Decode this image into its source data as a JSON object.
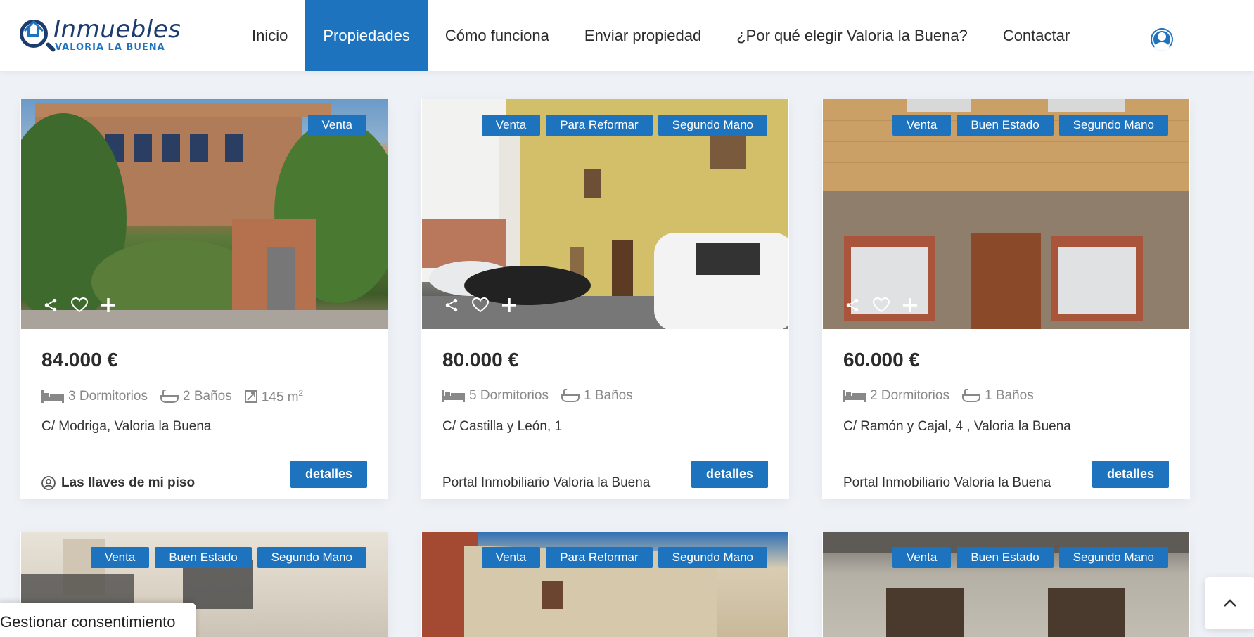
{
  "logo": {
    "brand": "Inmuebles",
    "sub": "VALORIA LA BUENA"
  },
  "nav": [
    {
      "label": "Inicio",
      "active": false
    },
    {
      "label": "Propiedades",
      "active": true
    },
    {
      "label": "Cómo funciona",
      "active": false
    },
    {
      "label": "Enviar propiedad",
      "active": false
    },
    {
      "label": "¿Por qué elegir Valoria la Buena?",
      "active": false
    },
    {
      "label": "Contactar",
      "active": false
    }
  ],
  "listings": [
    {
      "badges": [
        "Venta"
      ],
      "price": "84.000 €",
      "bedrooms": "3 Dormitorios",
      "baths": "2 Baños",
      "area": "145 m",
      "area_sup": "2",
      "address": "C/ Modriga, Valoria la Buena",
      "agent": "Las llaves de mi piso",
      "details": "detalles"
    },
    {
      "badges": [
        "Venta",
        "Para Reformar",
        "Segundo Mano"
      ],
      "price": "80.000 €",
      "bedrooms": "5 Dormitorios",
      "baths": "1 Baños",
      "address": "C/ Castilla y León, 1",
      "agent": "Portal Inmobiliario Valoria la Buena",
      "details": "detalles"
    },
    {
      "badges": [
        "Venta",
        "Buen Estado",
        "Segundo Mano"
      ],
      "price": "60.000 €",
      "bedrooms": "2 Dormitorios",
      "baths": "1 Baños",
      "address": "C/ Ramón y Cajal, 4 , Valoria la Buena",
      "agent": "Portal Inmobiliario Valoria la Buena",
      "details": "detalles"
    },
    {
      "badges": [
        "Venta",
        "Buen Estado",
        "Segundo Mano"
      ]
    },
    {
      "badges": [
        "Venta",
        "Para Reformar",
        "Segundo Mano"
      ]
    },
    {
      "badges": [
        "Venta",
        "Buen Estado",
        "Segundo Mano"
      ]
    }
  ],
  "consent": "Gestionar consentimiento",
  "colors": {
    "accent": "#1e73be",
    "logo_dark": "#1d3c6e"
  }
}
